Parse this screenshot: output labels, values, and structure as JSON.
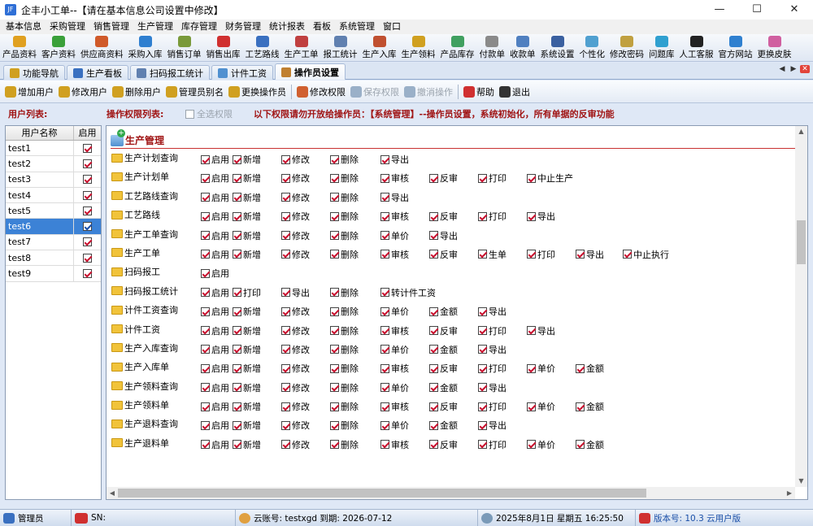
{
  "window": {
    "title": "企丰小工单--【请在基本信息公司设置中修改】",
    "app_icon": "JF",
    "minimize": "—",
    "maximize": "☐",
    "close": "✕"
  },
  "menu": [
    "基本信息",
    "采购管理",
    "销售管理",
    "生产管理",
    "库存管理",
    "财务管理",
    "统计报表",
    "看板",
    "系统管理",
    "窗口"
  ],
  "toolbar": [
    {
      "label": "产品资料",
      "color": "#e0a020"
    },
    {
      "label": "客户资料",
      "color": "#3aa03a"
    },
    {
      "label": "供应商资料",
      "color": "#d05a2a"
    },
    {
      "label": "采购入库",
      "color": "#2f7fd0"
    },
    {
      "label": "销售订单",
      "color": "#7a9a3a"
    },
    {
      "label": "销售出库",
      "color": "#d03030"
    },
    {
      "label": "工艺路线",
      "color": "#3a70c0"
    },
    {
      "label": "生产工单",
      "color": "#c04040"
    },
    {
      "label": "报工统计",
      "color": "#6080b0"
    },
    {
      "label": "生产入库",
      "color": "#c05030"
    },
    {
      "label": "生产领料",
      "color": "#d0a020"
    },
    {
      "label": "产品库存",
      "color": "#40a060"
    },
    {
      "label": "付款单",
      "color": "#8a8a8a"
    },
    {
      "label": "收款单",
      "color": "#5080c0"
    },
    {
      "label": "系统设置",
      "color": "#3a60a0"
    },
    {
      "label": "个性化",
      "color": "#50a0d0"
    },
    {
      "label": "修改密码",
      "color": "#c0a040"
    },
    {
      "label": "问题库",
      "color": "#30a0d0"
    },
    {
      "label": "人工客服",
      "color": "#222222"
    },
    {
      "label": "官方网站",
      "color": "#2f80d0"
    },
    {
      "label": "更换皮肤",
      "color": "#d060a0"
    }
  ],
  "tabs": [
    {
      "label": "功能导航",
      "active": false,
      "color": "#d0a020"
    },
    {
      "label": "生产看板",
      "active": false,
      "color": "#3a70c0"
    },
    {
      "label": "扫码报工统计",
      "active": false,
      "color": "#6080b0"
    },
    {
      "label": "计件工资",
      "active": false,
      "color": "#5090d0"
    },
    {
      "label": "操作员设置",
      "active": true,
      "color": "#c08030"
    }
  ],
  "tabnav": {
    "prev": "◀",
    "next": "▶",
    "close": "✕"
  },
  "actions": [
    {
      "label": "增加用户",
      "color": "#d0a020",
      "disabled": false
    },
    {
      "label": "修改用户",
      "color": "#d0a020",
      "disabled": false
    },
    {
      "label": "删除用户",
      "color": "#d0a020",
      "disabled": false
    },
    {
      "label": "管理员别名",
      "color": "#d0a020",
      "disabled": false
    },
    {
      "label": "更换操作员",
      "color": "#d0a020",
      "disabled": false
    },
    {
      "label": "修改权限",
      "color": "#d06030",
      "disabled": false
    },
    {
      "label": "保存权限",
      "color": "#9ab0c8",
      "disabled": true
    },
    {
      "label": "撤消操作",
      "color": "#9ab0c8",
      "disabled": true
    },
    {
      "label": "帮助",
      "color": "#d03030",
      "disabled": false
    },
    {
      "label": "退出",
      "color": "#333333",
      "disabled": false
    }
  ],
  "labels": {
    "user_list": "用户列表:",
    "perm_list": "操作权限列表:",
    "select_all": "全选权限",
    "notice": "以下权限请勿开放给操作员：【系统管理】--操作员设置，系统初始化，所有单据的反审功能"
  },
  "user_table": {
    "col_name": "用户名称",
    "col_enabled": "启用",
    "rows": [
      {
        "name": "test1",
        "enabled": true,
        "selected": false
      },
      {
        "name": "test2",
        "enabled": true,
        "selected": false
      },
      {
        "name": "test3",
        "enabled": true,
        "selected": false
      },
      {
        "name": "test4",
        "enabled": true,
        "selected": false
      },
      {
        "name": "test5",
        "enabled": true,
        "selected": false
      },
      {
        "name": "test6",
        "enabled": true,
        "selected": true
      },
      {
        "name": "test7",
        "enabled": true,
        "selected": false
      },
      {
        "name": "test8",
        "enabled": true,
        "selected": false
      },
      {
        "name": "test9",
        "enabled": true,
        "selected": false
      }
    ]
  },
  "section_title": "生产管理",
  "perm_rows": [
    {
      "name": "生产计划查询",
      "perms": [
        "启用",
        "新增",
        "修改",
        "删除",
        "导出"
      ]
    },
    {
      "name": "生产计划单",
      "perms": [
        "启用",
        "新增",
        "修改",
        "删除",
        "审核",
        "反审",
        "打印",
        "中止生产"
      ]
    },
    {
      "name": "工艺路线查询",
      "perms": [
        "启用",
        "新增",
        "修改",
        "删除",
        "导出"
      ]
    },
    {
      "name": "工艺路线",
      "perms": [
        "启用",
        "新增",
        "修改",
        "删除",
        "审核",
        "反审",
        "打印",
        "导出"
      ]
    },
    {
      "name": "生产工单查询",
      "perms": [
        "启用",
        "新增",
        "修改",
        "删除",
        "单价",
        "导出"
      ]
    },
    {
      "name": "生产工单",
      "perms": [
        "启用",
        "新增",
        "修改",
        "删除",
        "审核",
        "反审",
        "生单",
        "打印",
        "导出",
        "中止执行"
      ]
    },
    {
      "name": "扫码报工",
      "perms": [
        "启用"
      ]
    },
    {
      "name": "扫码报工统计",
      "perms": [
        "启用",
        "打印",
        "导出",
        "删除",
        "转计件工资"
      ]
    },
    {
      "name": "计件工资查询",
      "perms": [
        "启用",
        "新增",
        "修改",
        "删除",
        "单价",
        "金额",
        "导出"
      ]
    },
    {
      "name": "计件工资",
      "perms": [
        "启用",
        "新增",
        "修改",
        "删除",
        "审核",
        "反审",
        "打印",
        "导出"
      ]
    },
    {
      "name": "生产入库查询",
      "perms": [
        "启用",
        "新增",
        "修改",
        "删除",
        "单价",
        "金额",
        "导出"
      ]
    },
    {
      "name": "生产入库单",
      "perms": [
        "启用",
        "新增",
        "修改",
        "删除",
        "审核",
        "反审",
        "打印",
        "单价",
        "金额"
      ]
    },
    {
      "name": "生产领料查询",
      "perms": [
        "启用",
        "新增",
        "修改",
        "删除",
        "单价",
        "金额",
        "导出"
      ]
    },
    {
      "name": "生产领料单",
      "perms": [
        "启用",
        "新增",
        "修改",
        "删除",
        "审核",
        "反审",
        "打印",
        "单价",
        "金额"
      ]
    },
    {
      "name": "生产退料查询",
      "perms": [
        "启用",
        "新增",
        "修改",
        "删除",
        "单价",
        "金额",
        "导出"
      ]
    },
    {
      "name": "生产退料单",
      "perms": [
        "启用",
        "新增",
        "修改",
        "删除",
        "审核",
        "反审",
        "打印",
        "单价",
        "金额"
      ]
    }
  ],
  "status": {
    "role": "管理员",
    "sn_label": "SN:",
    "cloud": "云账号: testxgd   到期: 2026-07-12",
    "datetime": "2025年8月1日      星期五      16:25:50",
    "version": "版本号: 10.3 云用户版"
  }
}
